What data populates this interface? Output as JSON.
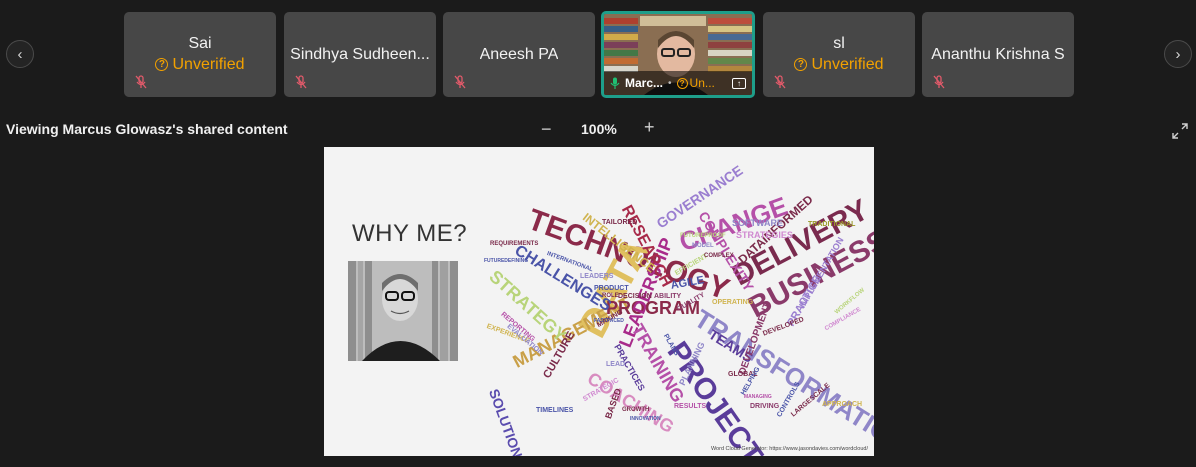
{
  "nav": {
    "prev": "‹",
    "next": "›"
  },
  "participants": [
    {
      "name": "Sai",
      "status": "Unverified"
    },
    {
      "name": "Sindhya Sudheen...",
      "status": ""
    },
    {
      "name": "Aneesh PA",
      "status": ""
    },
    {
      "name": "Marc...",
      "status": "Un...",
      "video": true
    },
    {
      "name": "sl",
      "status": "Unverified"
    },
    {
      "name": "Ananthu Krishna S",
      "status": ""
    }
  ],
  "share_bar": {
    "viewing_label": "Viewing Marcus Glowasz's shared content",
    "zoom_out": "−",
    "zoom_level": "100%",
    "zoom_in": "+"
  },
  "slide": {
    "title": "WHY ME?",
    "credit": "Word Cloud Generator: https://www.jasondavies.com/wordcloud/",
    "words": [
      "TECHNOLOGY",
      "DELIVERY",
      "BUSINESS",
      "TRANSFORMATION",
      "PROJECT",
      "DATA",
      "CHANGE",
      "MANAGEMENT",
      "PROGRAM",
      "STRATEGY",
      "CHALLENGES",
      "LEADERSHIP",
      "TRAINING",
      "COACHING",
      "SOLUTIONS",
      "RESEARCH",
      "GOVERNANCE",
      "COMPLEXITY",
      "DATAINFORMED",
      "INTELLIGENCE",
      "TEAMS",
      "CULTURE",
      "PRACTICE",
      "IMPLEMENTATION",
      "DEVELOPMENT",
      "PLANNING",
      "AGILE",
      "SOFTWARE",
      "STRATEGIES",
      "TRADITIONAL",
      "TAILORED",
      "REQUIREMENTS",
      "INTERNATIONAL",
      "FUTUREPROOF",
      "LEADERS",
      "PRODUCT",
      "DECISION",
      "ABILITY",
      "EFFICIENT",
      "OPERATING",
      "PLANS",
      "GLOBAL",
      "HELPING",
      "DRIVING",
      "CONTROLS",
      "LARGESCALE",
      "APPROACH",
      "TIMELINES",
      "BASED",
      "RESULTS",
      "PRACTICES",
      "LEAD",
      "MAKING",
      "DEVELOPED",
      "QUALITY",
      "MODEL",
      "ROLE",
      "FASTPACED",
      "COMPLEX",
      "EXPERIENCE",
      "REPORTING",
      "EVALUATION",
      "FUTUREDEFINING",
      "GROWTH",
      "INNOVATION",
      "MANAGING",
      "STRATEGIC",
      "COMPLIANCE",
      "WORKFLOW"
    ]
  }
}
